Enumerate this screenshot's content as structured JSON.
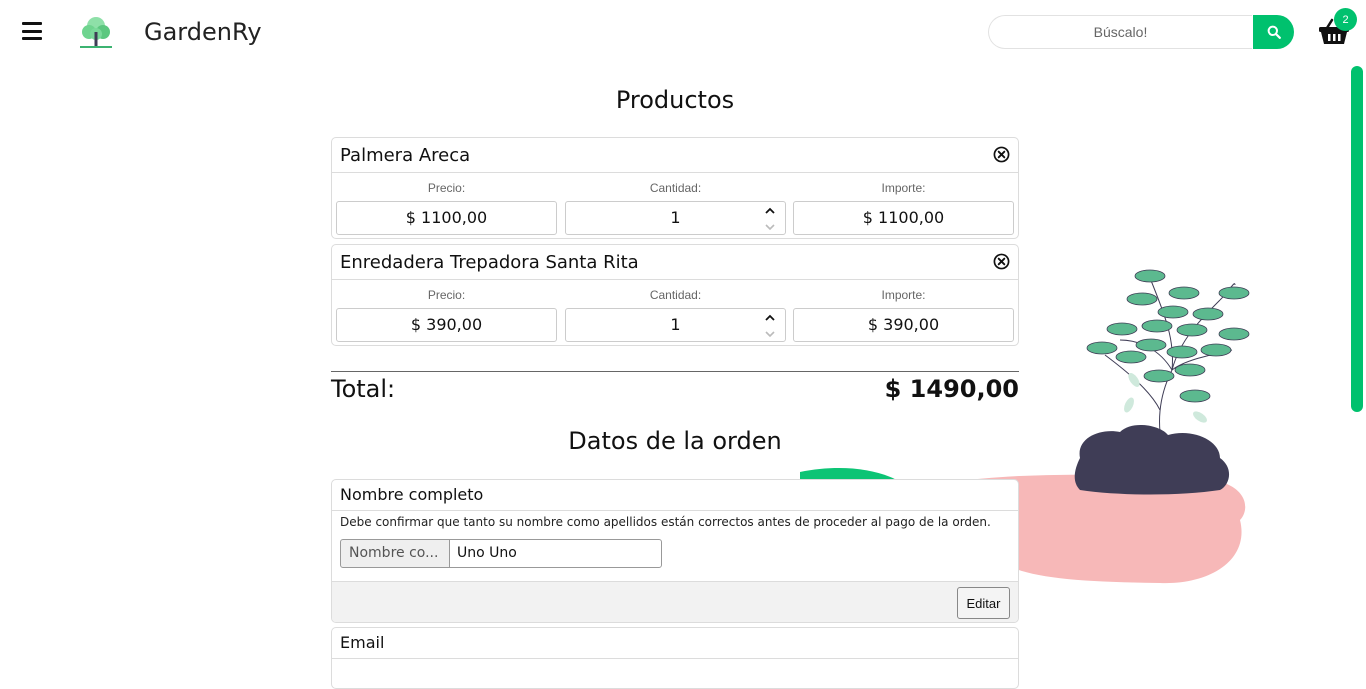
{
  "header": {
    "brand": "GardenRy",
    "search_placeholder": "Búscalo!",
    "cart_count": "2"
  },
  "products_section": {
    "title": "Productos"
  },
  "products": [
    {
      "name": "Palmera Areca",
      "price_label": "Precio:",
      "price": "$ 1100,00",
      "qty_label": "Cantidad:",
      "qty": "1",
      "amount_label": "Importe:",
      "amount": "$ 1100,00"
    },
    {
      "name": "Enredadera Trepadora Santa Rita",
      "price_label": "Precio:",
      "price": "$ 390,00",
      "qty_label": "Cantidad:",
      "qty": "1",
      "amount_label": "Importe:",
      "amount": "$ 390,00"
    }
  ],
  "total": {
    "label": "Total:",
    "value": "$ 1490,00"
  },
  "order_section": {
    "title": "Datos de la orden"
  },
  "name_card": {
    "title": "Nombre completo",
    "help": "Debe confirmar que tanto su nombre como apellidos están correctos antes de proceder al pago de la orden.",
    "addon": "Nombre co...",
    "value": "Uno Uno",
    "edit_label": "Editar"
  },
  "email_card": {
    "title": "Email"
  },
  "colors": {
    "accent": "#00c16e",
    "pot_pink": "#f7b8b8",
    "soil": "#3f3d56",
    "leaf": "#5cb98f"
  },
  "icons": [
    "menu-icon",
    "tree-logo-icon",
    "search-icon",
    "basket-icon",
    "remove-circle-icon",
    "chevron-up-icon",
    "chevron-down-icon"
  ]
}
